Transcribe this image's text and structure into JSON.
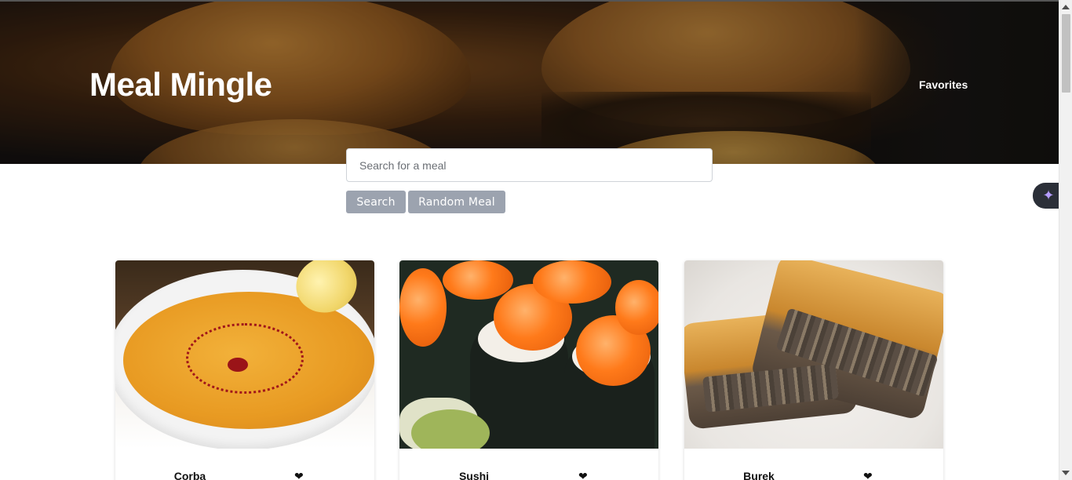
{
  "header": {
    "brand": "Meal Mingle",
    "nav_favorites": "Favorites"
  },
  "search": {
    "placeholder": "Search for a meal",
    "search_label": "Search",
    "random_label": "Random Meal"
  },
  "meals": [
    {
      "name": "Corba"
    },
    {
      "name": "Sushi"
    },
    {
      "name": "Burek"
    }
  ],
  "icons": {
    "heart": "heart-icon",
    "ai_assistant": "sparkle-icon"
  },
  "colors": {
    "button_bg": "#9ca3af",
    "button_text": "#ffffff",
    "hero_bg": "#121212"
  }
}
